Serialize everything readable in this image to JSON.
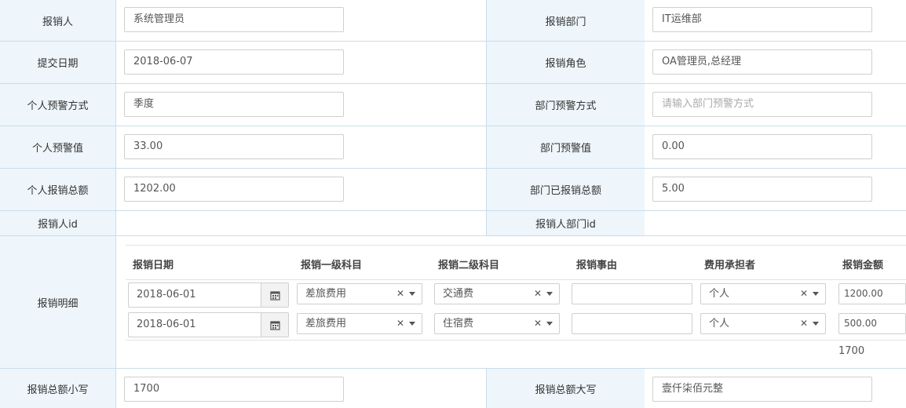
{
  "form": {
    "rows": [
      {
        "label1": "报销人",
        "value1": "系统管理员",
        "label2": "报销部门",
        "value2": "IT运维部"
      },
      {
        "label1": "提交日期",
        "value1": "2018-06-07",
        "label2": "报销角色",
        "value2": "OA管理员,总经理"
      },
      {
        "label1": "个人预警方式",
        "value1": "季度",
        "label2": "部门预警方式",
        "placeholder2": "请输入部门预警方式"
      },
      {
        "label1": "个人预警值",
        "value1": "33.00",
        "label2": "部门预警值",
        "value2": "0.00"
      },
      {
        "label1": "个人报销总额",
        "value1": "1202.00",
        "label2": "部门已报销总额",
        "value2": "5.00"
      },
      {
        "label1": "报销人id",
        "label2": "报销人部门id"
      }
    ],
    "detail_label": "报销明细",
    "total_lower_label": "报销总额小写",
    "total_lower_value": "1700",
    "total_upper_label": "报销总额大写",
    "total_upper_value": "壹仟柒佰元整"
  },
  "details": {
    "columns": [
      "报销日期",
      "报销一级科目",
      "报销二级科目",
      "报销事由",
      "费用承担者",
      "报销金额"
    ],
    "rows": [
      {
        "date": "2018-06-01",
        "cat1": "差旅费用",
        "cat2": "交通费",
        "reason": "",
        "bearer": "个人",
        "amount": "1200.00"
      },
      {
        "date": "2018-06-01",
        "cat1": "差旅费用",
        "cat2": "住宿费",
        "reason": "",
        "bearer": "个人",
        "amount": "500.00"
      }
    ],
    "sum": "1700",
    "clear_glyph": "✕"
  },
  "icons": {
    "calendar": "calendar-icon",
    "clear": "clear-icon",
    "dropdown": "chevron-down-icon"
  }
}
